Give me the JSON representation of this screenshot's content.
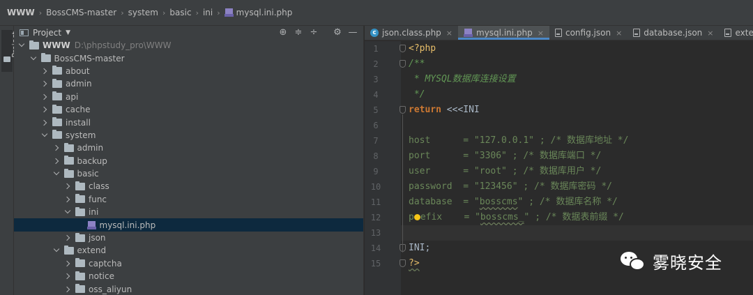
{
  "breadcrumb": [
    "WWW",
    "BossCMS-master",
    "system",
    "basic",
    "ini",
    "mysql.ini.php"
  ],
  "tool_strip": {
    "label": "Project"
  },
  "project_panel": {
    "title": "Project",
    "tools": [
      "target-icon",
      "expand-all-icon",
      "collapse-all-icon",
      "gear-icon",
      "minimize-icon"
    ],
    "tree": [
      {
        "label": "WWW",
        "path": "D:\\phpstudy_pro\\WWW",
        "depth": 0,
        "state": "open",
        "kind": "folder",
        "bold": true
      },
      {
        "label": "BossCMS-master",
        "depth": 1,
        "state": "open",
        "kind": "folder"
      },
      {
        "label": "about",
        "depth": 2,
        "state": "closed",
        "kind": "folder"
      },
      {
        "label": "admin",
        "depth": 2,
        "state": "closed",
        "kind": "folder"
      },
      {
        "label": "api",
        "depth": 2,
        "state": "closed",
        "kind": "folder"
      },
      {
        "label": "cache",
        "depth": 2,
        "state": "closed",
        "kind": "folder"
      },
      {
        "label": "install",
        "depth": 2,
        "state": "closed",
        "kind": "folder"
      },
      {
        "label": "system",
        "depth": 2,
        "state": "open",
        "kind": "folder"
      },
      {
        "label": "admin",
        "depth": 3,
        "state": "closed",
        "kind": "folder"
      },
      {
        "label": "backup",
        "depth": 3,
        "state": "closed",
        "kind": "folder"
      },
      {
        "label": "basic",
        "depth": 3,
        "state": "open",
        "kind": "folder"
      },
      {
        "label": "class",
        "depth": 4,
        "state": "closed",
        "kind": "folder"
      },
      {
        "label": "func",
        "depth": 4,
        "state": "closed",
        "kind": "folder"
      },
      {
        "label": "ini",
        "depth": 4,
        "state": "open",
        "kind": "folder"
      },
      {
        "label": "mysql.ini.php",
        "depth": 5,
        "state": "none",
        "kind": "php",
        "selected": true
      },
      {
        "label": "json",
        "depth": 4,
        "state": "closed",
        "kind": "folder"
      },
      {
        "label": "extend",
        "depth": 3,
        "state": "open",
        "kind": "folder"
      },
      {
        "label": "captcha",
        "depth": 4,
        "state": "closed",
        "kind": "folder"
      },
      {
        "label": "notice",
        "depth": 4,
        "state": "closed",
        "kind": "folder"
      },
      {
        "label": "oss_aliyun",
        "depth": 4,
        "state": "closed",
        "kind": "folder"
      }
    ]
  },
  "editor": {
    "tabs": [
      {
        "label": "json.class.php",
        "icon": "class-icon",
        "active": false
      },
      {
        "label": "mysql.ini.php",
        "icon": "php-file-icon",
        "active": true
      },
      {
        "label": "config.json",
        "icon": "json-file-icon",
        "active": false
      },
      {
        "label": "database.json",
        "icon": "json-file-icon",
        "active": false
      },
      {
        "label": "extension.json",
        "icon": "json-file-icon",
        "active": false
      }
    ],
    "current_line": 13,
    "lines": [
      "<?php",
      "/**",
      " * MYSQL数据库连接设置",
      " */",
      "return <<<INI",
      "",
      "host      = \"127.0.0.1\" ; /* 数据库地址 */",
      "port      = \"3306\" ; /* 数据库端口 */",
      "user      = \"root\" ; /* 数据库用户 */",
      "password  = \"123456\" ; /* 数据库密码 */",
      "database  = \"bosscms\" ; /* 数据库名称 */",
      "prefix    = \"bosscms_\" ; /* 数据表前缀 */",
      "",
      "INI;",
      "?>"
    ]
  },
  "watermark": {
    "text": "雾晓安全"
  },
  "colors": {
    "accent": "#4a88c7",
    "keyword": "#cc7832",
    "string": "#6a8759",
    "comment": "#629755"
  }
}
